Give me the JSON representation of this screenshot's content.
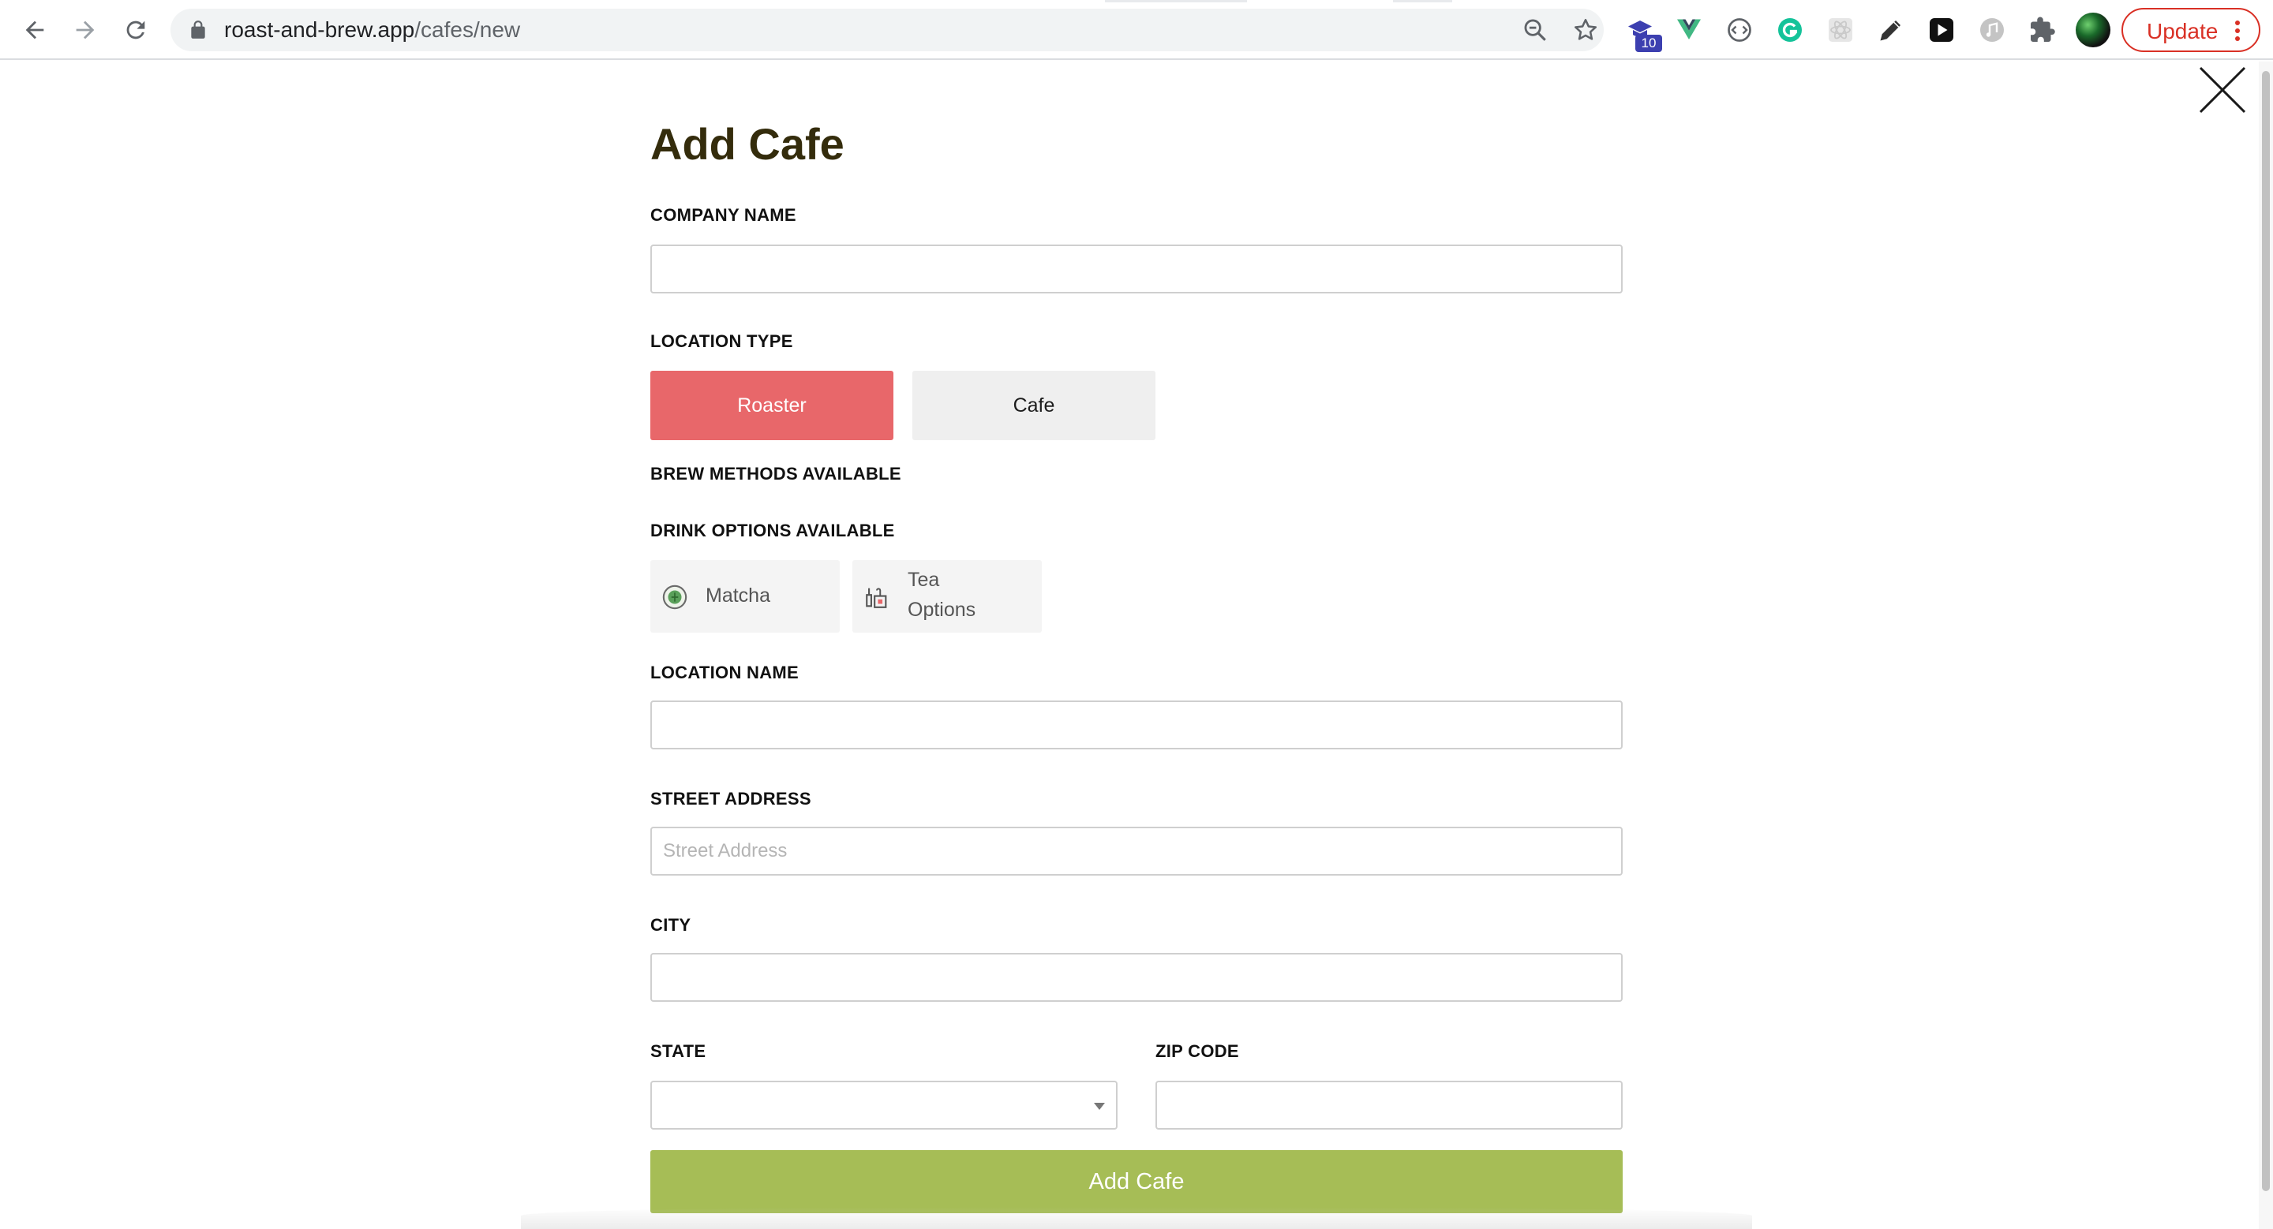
{
  "browser": {
    "url_host": "roast-and-brew.app",
    "url_path": "/cafes/new",
    "extension_badge": "10",
    "update_label": "Update"
  },
  "icons": {
    "back": "back-arrow-icon",
    "forward": "forward-arrow-icon",
    "reload": "reload-icon",
    "lock": "lock-icon",
    "zoom": "zoom-icon",
    "bookmark": "star-icon",
    "close": "close-icon",
    "matcha": "matcha-icon",
    "tea": "tea-icon"
  },
  "colors": {
    "accent_red": "#e8676a",
    "accent_green": "#a6bd56",
    "title_brown": "#342c0c"
  },
  "form": {
    "title": "Add Cafe",
    "company_name_label": "COMPANY NAME",
    "company_name_value": "",
    "location_type_label": "LOCATION TYPE",
    "location_types": [
      {
        "label": "Roaster",
        "selected": true
      },
      {
        "label": "Cafe",
        "selected": false
      }
    ],
    "brew_methods_label": "BREW METHODS AVAILABLE",
    "drink_options_label": "DRINK OPTIONS AVAILABLE",
    "drink_options": [
      {
        "line1": "Matcha",
        "line2": ""
      },
      {
        "line1": "Tea",
        "line2": "Options"
      }
    ],
    "location_name_label": "LOCATION NAME",
    "location_name_value": "",
    "street_address_label": "STREET ADDRESS",
    "street_address_placeholder": "Street Address",
    "city_label": "CITY",
    "city_value": "",
    "state_label": "STATE",
    "state_value": "",
    "zip_label": "ZIP CODE",
    "zip_value": "",
    "submit_label": "Add Cafe"
  }
}
